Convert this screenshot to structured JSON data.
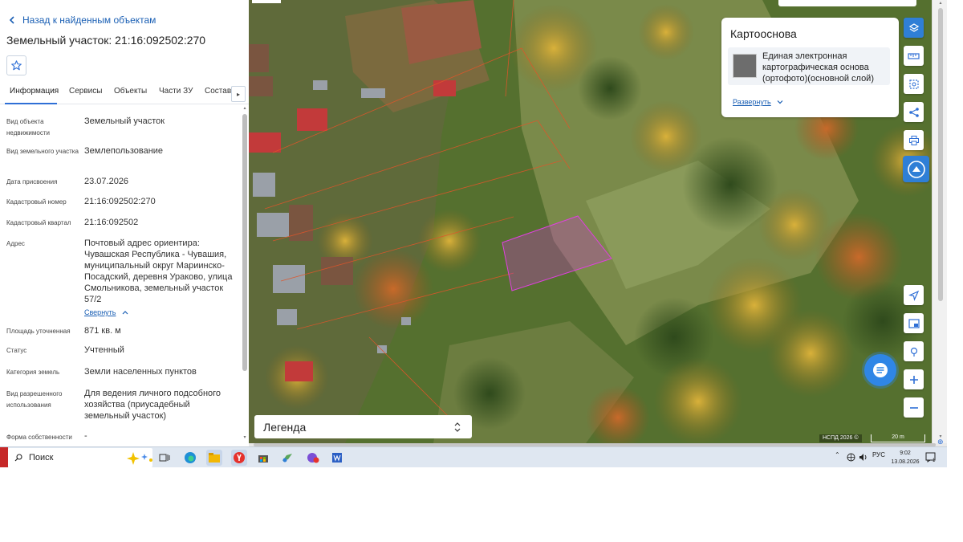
{
  "panel": {
    "back_link": "Назад к найденным объектам",
    "title": "Земельный участок: 21:16:092502:270",
    "favorite_icon": "star-outline-icon",
    "tabs": [
      {
        "label": "Информация",
        "active": true
      },
      {
        "label": "Сервисы",
        "active": false
      },
      {
        "label": "Объекты",
        "active": false
      },
      {
        "label": "Части ЗУ",
        "active": false
      },
      {
        "label": "Состав",
        "active": false
      }
    ],
    "fields": [
      {
        "label": "Вид объекта недвижимости",
        "value": "Земельный участок"
      },
      {
        "label": "Вид земельного участка",
        "value": "Землепользование"
      },
      {
        "label": "Дата присвоения",
        "value": "23.07.2026"
      },
      {
        "label": "Кадастровый номер",
        "value": "21:16:092502:270"
      },
      {
        "label": "Кадастровый квартал",
        "value": "21:16:092502"
      },
      {
        "label": "Адрес",
        "value": "Почтовый адрес ориентира: Чувашская Республика - Чувашия, муниципальный округ Мариинско-Посадский, деревня Ураково, улица Смольникова, земельный участок 57/2"
      },
      {
        "label": "Площадь уточненная",
        "value": "871 кв. м"
      },
      {
        "label": "Статус",
        "value": "Учтенный"
      },
      {
        "label": "Категория земель",
        "value": "Земли населенных пунктов"
      },
      {
        "label": "Вид разрешенного использования",
        "value": "Для ведения личного подсобного хозяйства (приусадебный земельный участок)"
      },
      {
        "label": "Форма собственности",
        "value": "-"
      }
    ],
    "collapse_link": "Свернуть"
  },
  "map": {
    "basemap": {
      "title": "Картооснова",
      "item": "Единая электронная картографическая основа (ортофото)(основной слой)",
      "expand": "Развернуть"
    },
    "tools_top": [
      "layers-icon",
      "ruler-icon",
      "select-area-icon",
      "share-icon",
      "print-icon",
      "logo-button-icon"
    ],
    "tools_bottom": [
      "locate-icon",
      "picture-in-picture-icon",
      "geo-search-icon",
      "zoom-in-icon",
      "zoom-out-icon"
    ],
    "legend_label": "Легенда",
    "attribution": "НСПД 2026 ©",
    "scale_label": "20 m",
    "colors": {
      "accent": "#2f7fd6",
      "parcel_fill": "#c43bc4",
      "boundary": "#e0552a"
    }
  },
  "taskbar": {
    "search_placeholder": "Поиск",
    "apps": [
      "task-view-icon",
      "edge-icon",
      "file-explorer-icon",
      "yandex-browser-icon",
      "store-icon",
      "photos-icon",
      "app-red-badge-icon",
      "word-icon"
    ],
    "language": "РУС",
    "time": "9:02",
    "date": "13.08.2026"
  }
}
